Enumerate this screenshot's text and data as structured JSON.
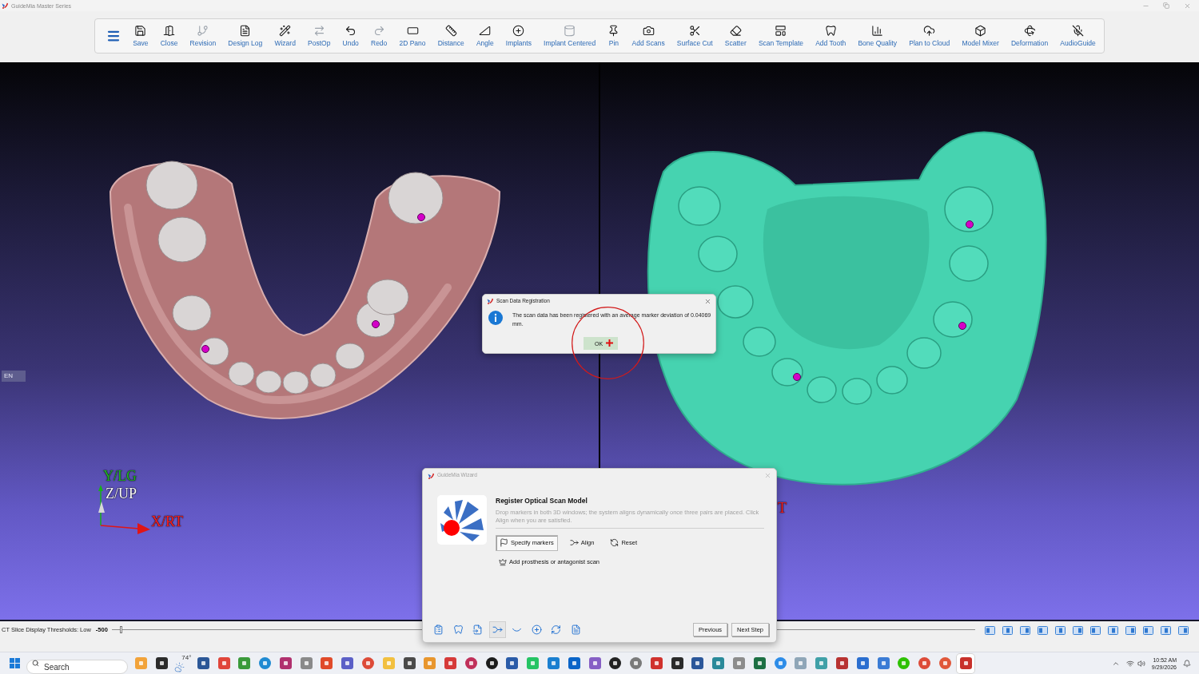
{
  "window": {
    "title": "GuideMia Master Series"
  },
  "toolbar": {
    "items": [
      {
        "label": "Save",
        "disabled": false
      },
      {
        "label": "Close",
        "disabled": false
      },
      {
        "label": "Revision",
        "disabled": true
      },
      {
        "label": "Design Log",
        "disabled": false
      },
      {
        "label": "Wizard",
        "disabled": false
      },
      {
        "label": "PostOp",
        "disabled": true
      },
      {
        "label": "Undo",
        "disabled": false
      },
      {
        "label": "Redo",
        "disabled": true
      },
      {
        "label": "2D Pano",
        "disabled": false
      },
      {
        "label": "Distance",
        "disabled": false
      },
      {
        "label": "Angle",
        "disabled": false
      },
      {
        "label": "Implants",
        "disabled": false
      },
      {
        "label": "Implant Centered",
        "disabled": true
      },
      {
        "label": "Pin",
        "disabled": false
      },
      {
        "label": "Add Scans",
        "disabled": false
      },
      {
        "label": "Surface Cut",
        "disabled": false
      },
      {
        "label": "Scatter",
        "disabled": false
      },
      {
        "label": "Scan Template",
        "disabled": false
      },
      {
        "label": "Add Tooth",
        "disabled": false
      },
      {
        "label": "Bone Quality",
        "disabled": false
      },
      {
        "label": "Plan to Cloud",
        "disabled": false
      },
      {
        "label": "Model Mixer",
        "disabled": false
      },
      {
        "label": "Deformation",
        "disabled": false
      },
      {
        "label": "AudioGuide",
        "disabled": false
      }
    ]
  },
  "viewports": [
    {
      "axis_labels": [
        {
          "text": "Y/LG",
          "color": "#22b422"
        },
        {
          "text": "Z/UP",
          "color": "#ffffff"
        },
        {
          "text": "X/RT",
          "color": "#ff1f1f"
        }
      ]
    },
    {
      "axis_labels": [
        {
          "text": "T",
          "color": "#ff1f1f"
        }
      ]
    }
  ],
  "language_indicator": "EN",
  "registration_dialog": {
    "title": "Scan Data Registration",
    "message": "The scan data has been registered with an average marker deviation of 0.04069 mm.",
    "ok_button": "OK"
  },
  "threshold_bar": {
    "label": "CT Slice Display Thresholds: Low",
    "value": "-500",
    "level": 0.01
  },
  "wizard": {
    "title": "GuideMia Wizard",
    "heading": "Register Optical Scan Model",
    "description": "Drop markers in both 3D windows; the system aligns dynamically once three pairs are placed. Click Align when you are satisfied.",
    "actions": [
      {
        "label": "Specify markers",
        "selected": true
      },
      {
        "label": "Align",
        "selected": false
      },
      {
        "label": "Reset",
        "selected": false
      }
    ],
    "extra_action": "Add prosthesis or antagonist scan",
    "steps": [
      {
        "selected": false
      },
      {
        "selected": false
      },
      {
        "selected": false
      },
      {
        "selected": true
      },
      {
        "selected": false
      },
      {
        "selected": false
      },
      {
        "selected": false
      },
      {
        "selected": false
      }
    ],
    "buttons": [
      "Previous",
      "Next Step"
    ]
  },
  "taskbar": {
    "search": {
      "placeholder": "Search"
    },
    "apps": [
      {
        "selected": false
      },
      {
        "selected": false
      },
      {
        "selected": false,
        "badge": "74°"
      },
      {
        "selected": false
      },
      {
        "selected": false
      },
      {
        "selected": false
      },
      {
        "selected": false
      },
      {
        "selected": false
      },
      {
        "selected": false
      },
      {
        "selected": false
      },
      {
        "selected": false
      },
      {
        "selected": false
      },
      {
        "selected": false
      },
      {
        "selected": false
      },
      {
        "selected": false
      },
      {
        "selected": false
      },
      {
        "selected": false
      },
      {
        "selected": false
      },
      {
        "selected": false
      },
      {
        "selected": false
      },
      {
        "selected": false
      },
      {
        "selected": false
      },
      {
        "selected": false
      },
      {
        "selected": false
      },
      {
        "selected": false
      },
      {
        "selected": false
      },
      {
        "selected": false
      },
      {
        "selected": false
      },
      {
        "selected": false
      },
      {
        "selected": false
      },
      {
        "selected": false
      },
      {
        "selected": false
      },
      {
        "selected": false
      },
      {
        "selected": false
      },
      {
        "selected": false
      },
      {
        "selected": false
      },
      {
        "selected": false
      },
      {
        "selected": false
      },
      {
        "selected": false
      },
      {
        "selected": false
      },
      {
        "selected": true
      }
    ],
    "clock": {
      "time": "10:52 AM",
      "date": "9/29/2026"
    }
  }
}
